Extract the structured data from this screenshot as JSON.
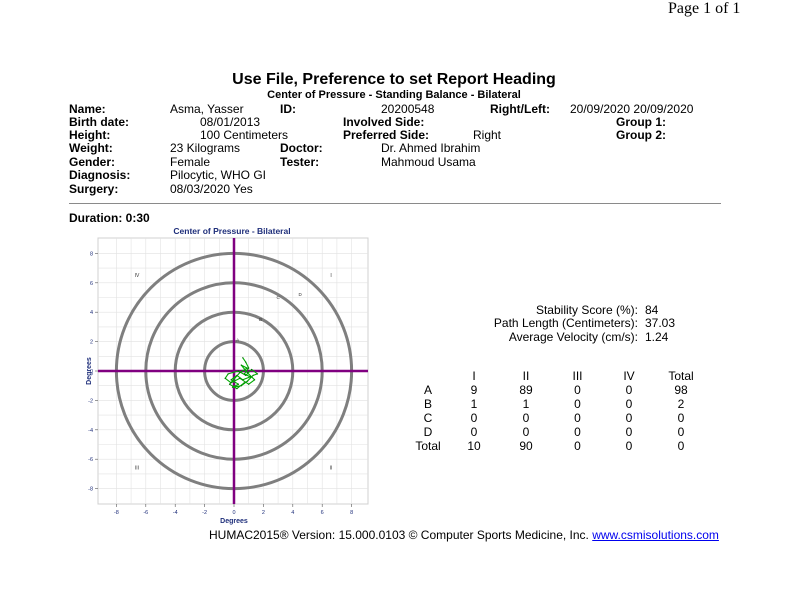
{
  "page_number": "Page 1 of 1",
  "report": {
    "heading": "Use File, Preference to set Report Heading",
    "test_name": "Center of Pressure - Standing Balance - Bilateral"
  },
  "patient": {
    "name_label": "Name:",
    "name": "Asma, Yasser",
    "id_label": "ID:",
    "id": "20200548",
    "right_left_label": "Right/Left:",
    "right_left": "20/09/2020 20/09/2020",
    "birth_label": "Birth date:",
    "birth": "08/01/2013",
    "involved_label": "Involved Side:",
    "group1_label": "Group 1:",
    "height_label": "Height:",
    "height": "100 Centimeters",
    "preferred_label": "Preferred Side:",
    "preferred": "Right",
    "group2_label": "Group 2:",
    "weight_label": "Weight:",
    "weight": "23 Kilograms",
    "doctor_label": "Doctor:",
    "doctor": "Dr. Ahmed Ibrahim",
    "gender_label": "Gender:",
    "gender": "Female",
    "tester_label": "Tester:",
    "tester": "Mahmoud Usama",
    "diagnosis_label": "Diagnosis:",
    "diagnosis": "Pilocytic, WHO GI",
    "surgery_label": "Surgery:",
    "surgery": "08/03/2020 Yes"
  },
  "duration": "Duration: 0:30",
  "metrics": {
    "stability_label": "Stability Score (%):",
    "stability": "84",
    "path_label": "Path Length (Centimeters):",
    "path": "37.03",
    "velocity_label": "Average Velocity (cm/s):",
    "velocity": "1.24"
  },
  "zone_table": {
    "headers": [
      "",
      "I",
      "II",
      "III",
      "IV",
      "Total"
    ],
    "rows": [
      [
        "A",
        "9",
        "89",
        "0",
        "0",
        "98"
      ],
      [
        "B",
        "1",
        "1",
        "0",
        "0",
        "2"
      ],
      [
        "C",
        "0",
        "0",
        "0",
        "0",
        "0"
      ],
      [
        "D",
        "0",
        "0",
        "0",
        "0",
        "0"
      ],
      [
        "Total",
        "10",
        "90",
        "0",
        "0",
        "0"
      ]
    ]
  },
  "footer": {
    "text": "HUMAC2015® Version: 15.000.0103 © Computer Sports Medicine, Inc.",
    "link": "www.csmisolutions.com"
  },
  "chart_data": {
    "type": "scatter",
    "title": "Center of Pressure - Bilateral",
    "xlabel": "Degrees",
    "ylabel": "Degrees",
    "xlim": [
      -8,
      8
    ],
    "ylim": [
      -8,
      8
    ],
    "x_ticks": [
      "-8",
      "-6",
      "-4",
      "-2",
      "0",
      "2",
      "4",
      "6",
      "8"
    ],
    "y_ticks": [
      "8",
      "6",
      "4",
      "2",
      "0",
      "-2",
      "-4",
      "-6",
      "-8"
    ],
    "quadrant_labels": [
      "I",
      "II",
      "III",
      "IV"
    ],
    "ring_labels": [
      "A",
      "B",
      "C",
      "D"
    ],
    "ring_radii_degrees": [
      2,
      4,
      6,
      8
    ],
    "grid": true,
    "colors": {
      "rings": "#7f7f7f",
      "axes": "#800080",
      "trace": "#00aa00",
      "title": "#1e2e7a"
    },
    "series": [
      {
        "values": [
          [
            0.6,
            0.9
          ],
          [
            0.8,
            0.6
          ],
          [
            1.0,
            0.2
          ],
          [
            0.7,
            -0.2
          ],
          [
            1.1,
            -0.4
          ],
          [
            0.6,
            -0.6
          ],
          [
            0.2,
            -0.3
          ],
          [
            -0.2,
            -0.6
          ],
          [
            0.3,
            -0.9
          ],
          [
            -0.1,
            -1.1
          ],
          [
            0.5,
            -1.0
          ],
          [
            0.9,
            -0.7
          ],
          [
            1.3,
            -0.3
          ],
          [
            1.6,
            -0.2
          ],
          [
            1.2,
            0.1
          ],
          [
            0.8,
            -0.3
          ],
          [
            0.3,
            0.0
          ],
          [
            -0.4,
            -0.2
          ],
          [
            -0.6,
            -0.5
          ],
          [
            -0.2,
            -0.8
          ],
          [
            0.4,
            -0.5
          ],
          [
            1.0,
            -0.9
          ],
          [
            1.4,
            -0.6
          ],
          [
            0.9,
            -0.1
          ],
          [
            0.5,
            0.4
          ],
          [
            0.9,
            0.2
          ],
          [
            0.4,
            -0.1
          ],
          [
            -0.3,
            -0.9
          ],
          [
            0.2,
            -1.2
          ],
          [
            0.7,
            -0.8
          ]
        ]
      }
    ]
  }
}
